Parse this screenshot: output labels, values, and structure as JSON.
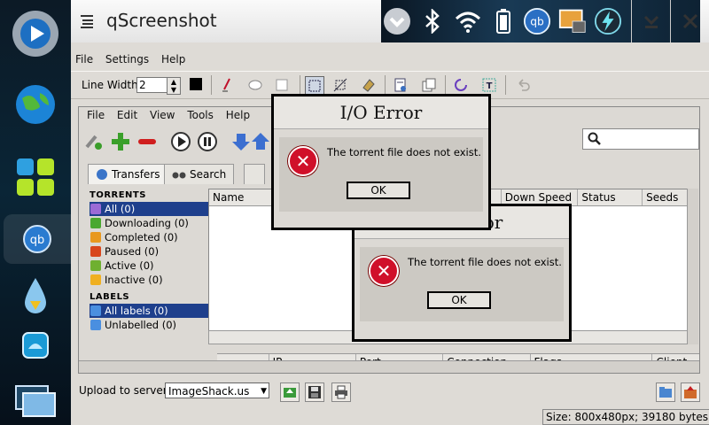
{
  "window": {
    "title": "qScreenshot"
  },
  "app_menu": [
    "File",
    "Settings",
    "Help"
  ],
  "toolbar": {
    "line_width_label": "Line Width:",
    "line_width_value": "2",
    "color": "#000000"
  },
  "canvas": {
    "menu": [
      "File",
      "Edit",
      "View",
      "Tools",
      "Help"
    ],
    "tabs": [
      "Transfers",
      "Search"
    ],
    "torrents_heading": "TORRENTS",
    "torrent_filters": [
      "All (0)",
      "Downloading (0)",
      "Completed (0)",
      "Paused (0)",
      "Active (0)",
      "Inactive (0)"
    ],
    "labels_heading": "LABELS",
    "label_filters": [
      "All labels (0)",
      "Unlabelled (0)"
    ],
    "columns": [
      "Name",
      "Down Speed",
      "Status",
      "Seeds"
    ],
    "peer_columns": [
      "IP",
      "Port",
      "Connection",
      "Flags",
      "Client"
    ]
  },
  "dialog1": {
    "title": "I/O Error",
    "message": "The torrent file does not exist.",
    "ok": "OK"
  },
  "dialog2": {
    "title": "I/O Error",
    "message": "The torrent file does not exist.",
    "ok": "OK"
  },
  "bottom": {
    "upload_label": "Upload to server:",
    "upload_server": "ImageShack.us",
    "size_text": "Size: 800x480px; 39180 bytes"
  },
  "icons": {
    "dock": [
      "media-player-icon",
      "web-browser-icon",
      "app-grid-icon",
      "qbittorrent-icon",
      "drop-icon",
      "photo-icon",
      "desktop-icon"
    ],
    "status": [
      "chevron-down-circle-icon",
      "bluetooth-icon",
      "wifi-icon",
      "battery-icon",
      "qbittorrent-icon",
      "image-viewer-icon",
      "lightning-icon"
    ]
  },
  "colors": {
    "selection": "#1e3f8c",
    "error": "#d0102a"
  }
}
